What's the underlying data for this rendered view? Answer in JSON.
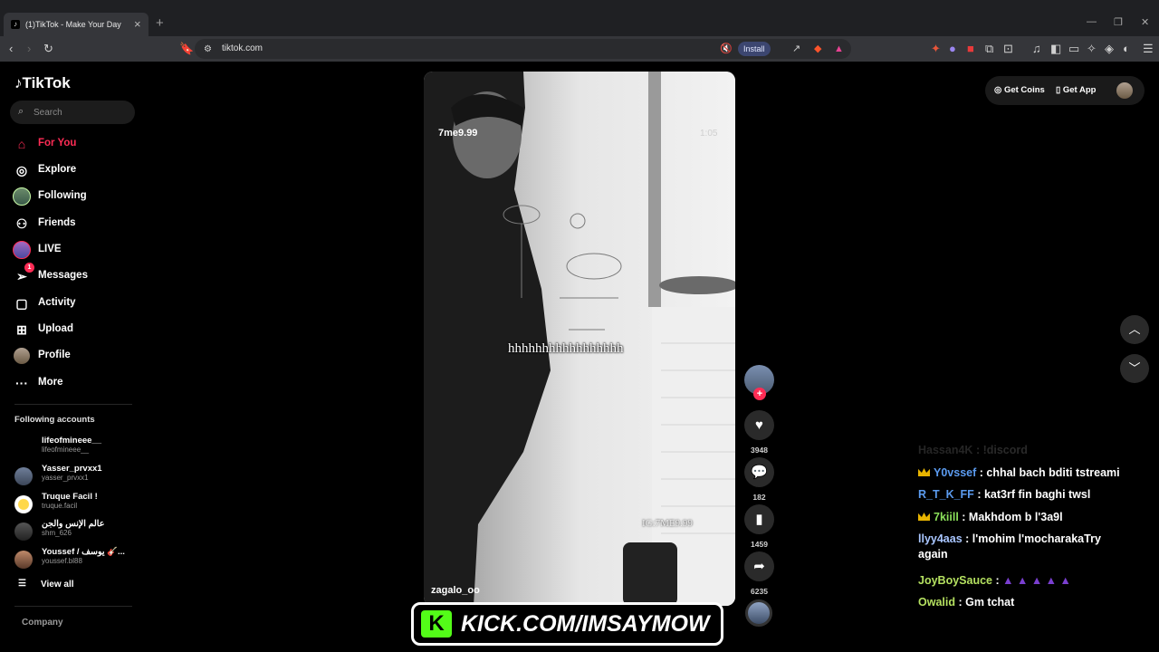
{
  "browser": {
    "tab_title": "(1)TikTok - Make Your Day",
    "tab_favicon": "tiktok-icon",
    "url": "tiktok.com",
    "install_label": "Install"
  },
  "sidebar": {
    "logo": "TikTok",
    "search_placeholder": "Search",
    "nav": [
      {
        "label": "For You",
        "icon": "home-icon"
      },
      {
        "label": "Explore",
        "icon": "compass-icon"
      },
      {
        "label": "Following",
        "icon": "following-avatar"
      },
      {
        "label": "Friends",
        "icon": "friends-icon"
      },
      {
        "label": "LIVE",
        "icon": "live-icon"
      },
      {
        "label": "Messages",
        "icon": "messages-icon",
        "badge": "1"
      },
      {
        "label": "Activity",
        "icon": "activity-icon"
      },
      {
        "label": "Upload",
        "icon": "upload-icon"
      },
      {
        "label": "Profile",
        "icon": "profile-avatar"
      },
      {
        "label": "More",
        "icon": "more-icon"
      }
    ],
    "following_title": "Following accounts",
    "accounts": [
      {
        "name": "lifeofmineee__",
        "handle": "lifeofmineee__"
      },
      {
        "name": "Yasser_prvxx1",
        "handle": "yasser_prvxx1"
      },
      {
        "name": "Truque Facil !",
        "handle": "truque.facil"
      },
      {
        "name": "عالم الإنس والجن",
        "handle": "shm_626"
      },
      {
        "name": "Youssef / يوسف 🎸...",
        "handle": "youssef.bl88"
      }
    ],
    "view_all": "View all",
    "company": "Company"
  },
  "video": {
    "overlay_user": "7me9.99",
    "overlay_time": "1:05",
    "caption": "hhhhhhhhhhhhhhhhh",
    "watermark": "IG:7ME9.99",
    "author": "zagalo_oo"
  },
  "actions": {
    "likes": "3948",
    "comments": "182",
    "saves": "1459",
    "shares": "6235"
  },
  "topright": {
    "get_coins": "Get Coins",
    "get_app": "Get App"
  },
  "chat": [
    {
      "user": "Hassan4K",
      "msg": ": !discord",
      "color": "#6b6b6b",
      "crown": false,
      "faded": true
    },
    {
      "user": "Y0vssef",
      "msg": ": chhal bach bditi tstreami",
      "color": "#5b9bf0",
      "crown": true
    },
    {
      "user": "R_T_K_FF",
      "msg": ": kat3rf fin baghi twsl",
      "color": "#5b9bf0",
      "crown": false
    },
    {
      "user": "7kiill",
      "msg": ": Makhdom b l'3a9l",
      "color": "#8be05a",
      "crown": true
    },
    {
      "user": "llyy4aas",
      "msg": ": l'mohim l'mocharakaTry again",
      "color": "#a9c6ff",
      "crown": false
    },
    {
      "user": "JoyBoySauce",
      "msg": ":",
      "color": "#b4e060",
      "crown": false,
      "emotes": 5
    },
    {
      "user": "Owalid",
      "msg": ": Gm tchat",
      "color": "#b4e060",
      "crown": false
    }
  ],
  "kick_banner": {
    "logo_letter": "K",
    "text": "KICK.COM/IMSAYMOW",
    "brand_color": "#53fc18"
  },
  "colors": {
    "accent": "#fe2c55"
  }
}
